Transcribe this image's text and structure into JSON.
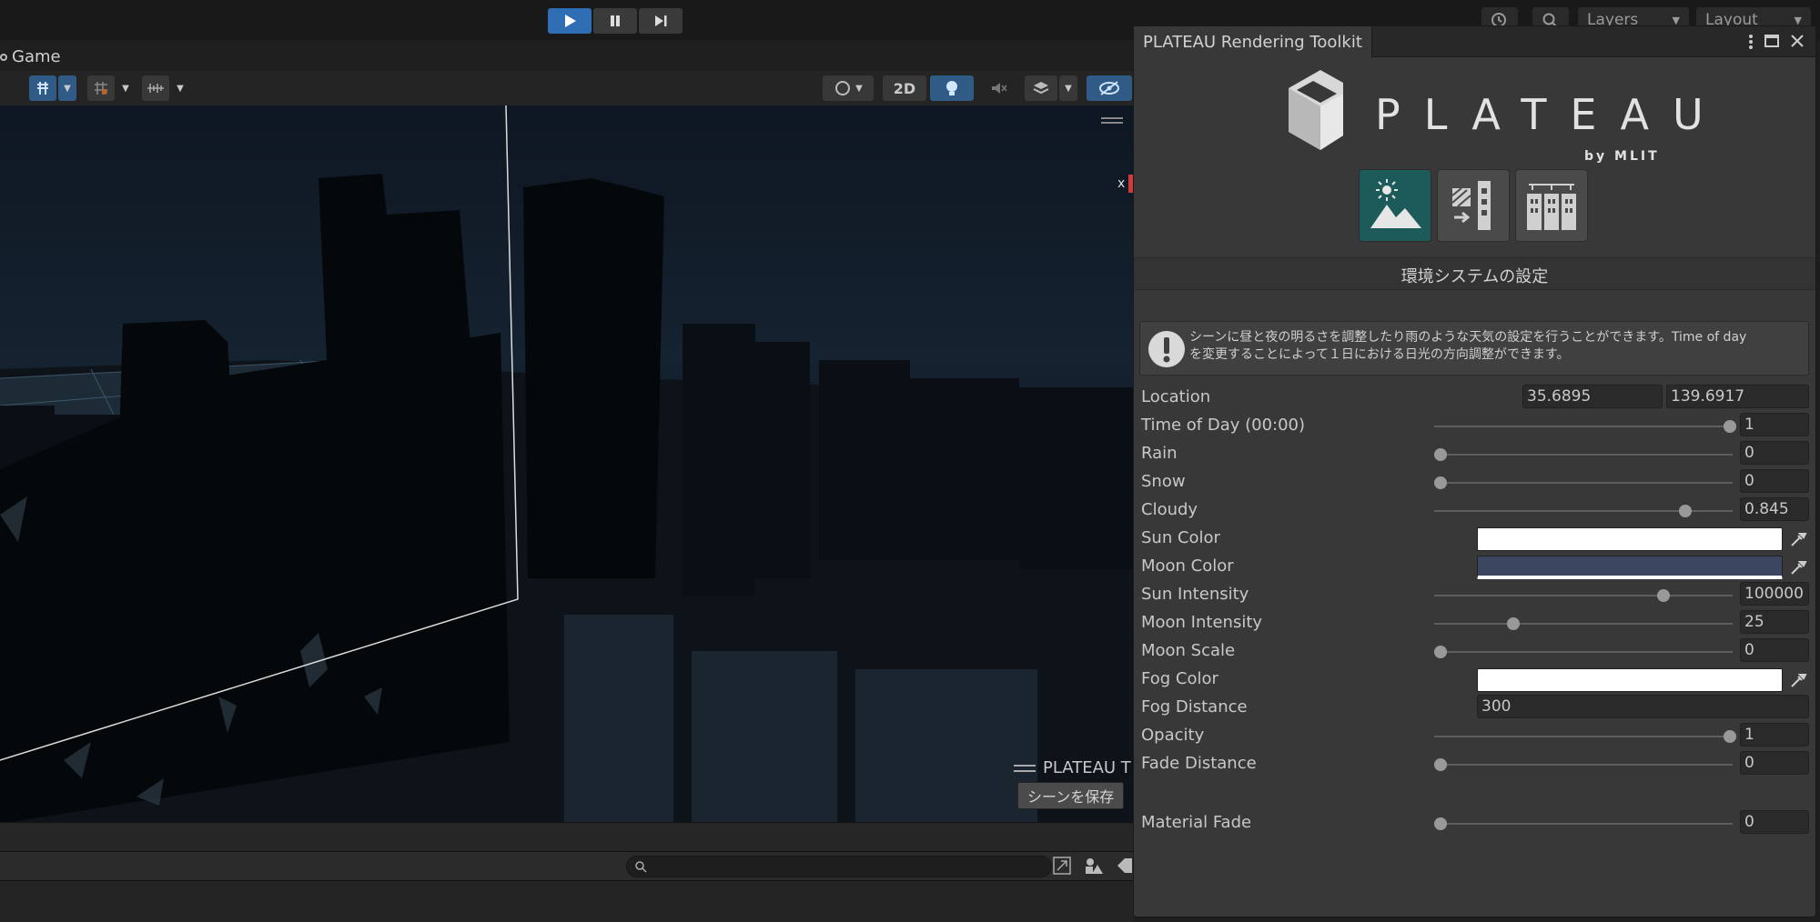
{
  "toolbar": {
    "play_icon": "play-icon",
    "pause_icon": "pause-icon",
    "step_icon": "step-icon",
    "layers_label": "Layers",
    "layout_label": "Layout"
  },
  "scene": {
    "tab_label": "Game",
    "view_2d_label": "2D",
    "overlay_title": "PLATEAU T",
    "save_scene_button": "シーンを保存",
    "axis_label": "x"
  },
  "toolkit": {
    "title": "PLATEAU Rendering Toolkit",
    "logo_text": "PLATEAU",
    "logo_sub": "by MLIT",
    "section_title": "環境システムの設定",
    "info_line1": "シーンに昼と夜の明るさを調整したり雨のような天気の設定を行うことができます。Time of day",
    "info_line2": "を変更することによって１日における日光の方向調整ができます。",
    "accent_color": "#1d5a5a",
    "rows": {
      "location": {
        "label": "Location",
        "lat": "35.6895",
        "lon": "139.6917"
      },
      "time_of_day": {
        "label": "Time of Day (00:00)",
        "value": "1",
        "level": 1.0
      },
      "rain": {
        "label": "Rain",
        "value": "0",
        "level": 0.0
      },
      "snow": {
        "label": "Snow",
        "value": "0",
        "level": 0.0
      },
      "cloudy": {
        "label": "Cloudy",
        "value": "0.845",
        "level": 0.845
      },
      "sun_color": {
        "label": "Sun Color",
        "color": "#ffffff"
      },
      "moon_color": {
        "label": "Moon Color",
        "color": "#3b4660"
      },
      "sun_intensity": {
        "label": "Sun Intensity",
        "value": "100000",
        "level": 0.77
      },
      "moon_intensity": {
        "label": "Moon Intensity",
        "value": "25",
        "level": 0.25
      },
      "moon_scale": {
        "label": "Moon Scale",
        "value": "0",
        "level": 0.0
      },
      "fog_color": {
        "label": "Fog Color",
        "color": "#ffffff"
      },
      "fog_distance": {
        "label": "Fog Distance",
        "value": "300"
      },
      "opacity": {
        "label": "Opacity",
        "value": "1",
        "level": 1.0
      },
      "fade_distance": {
        "label": "Fade Distance",
        "value": "0",
        "level": 0.0
      },
      "material_fade": {
        "label": "Material Fade",
        "value": "0",
        "level": 0.0
      }
    }
  }
}
